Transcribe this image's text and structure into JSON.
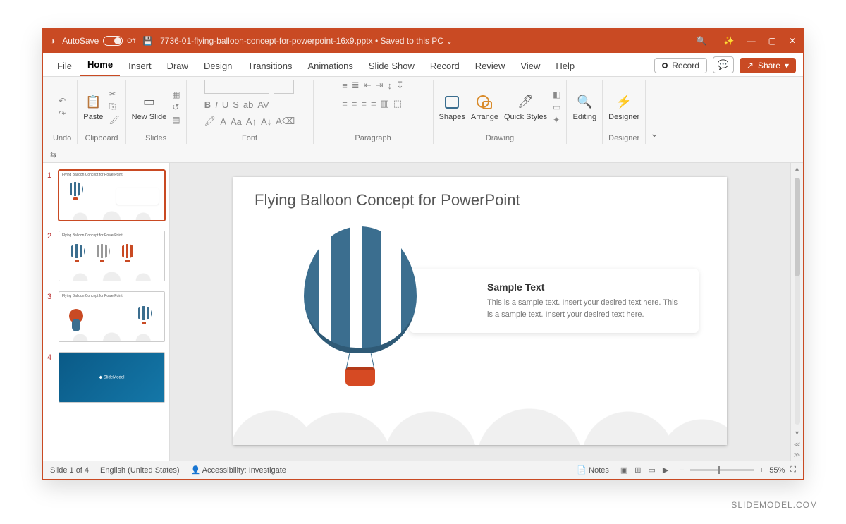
{
  "titlebar": {
    "autosave_label": "AutoSave",
    "autosave_state": "Off",
    "filename": "7736-01-flying-balloon-concept-for-powerpoint-16x9.pptx",
    "save_status": "Saved to this PC"
  },
  "menu": {
    "tabs": [
      "File",
      "Home",
      "Insert",
      "Draw",
      "Design",
      "Transitions",
      "Animations",
      "Slide Show",
      "Record",
      "Review",
      "View",
      "Help"
    ],
    "active": "Home",
    "record_btn": "Record",
    "share_btn": "Share"
  },
  "ribbon": {
    "undo": "Undo",
    "clipboard": {
      "label": "Clipboard",
      "paste": "Paste"
    },
    "slides": {
      "label": "Slides",
      "new": "New Slide"
    },
    "font": "Font",
    "paragraph": "Paragraph",
    "drawing": {
      "label": "Drawing",
      "shapes": "Shapes",
      "arrange": "Arrange",
      "quick": "Quick Styles"
    },
    "editing": "Editing",
    "designer": "Designer"
  },
  "thumbs": {
    "count": 4,
    "title": "Flying Balloon Concept for PowerPoint"
  },
  "slide": {
    "title": "Flying Balloon Concept for PowerPoint",
    "card_heading": "Sample Text",
    "card_body": "This is a sample text. Insert your desired text here. This is a sample text. Insert your desired text here."
  },
  "status": {
    "slide": "Slide 1 of 4",
    "lang": "English (United States)",
    "access": "Accessibility: Investigate",
    "notes": "Notes",
    "zoom": "55%"
  },
  "watermark": "SLIDEMODEL.COM"
}
